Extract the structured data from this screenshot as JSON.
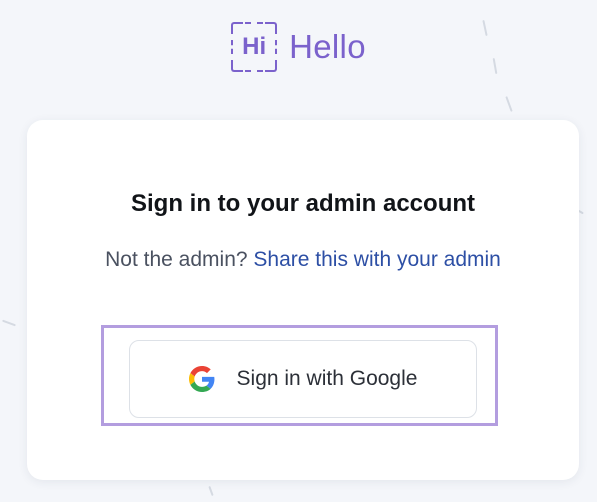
{
  "brand": {
    "mark_text": "Hi",
    "name": "Hello",
    "color": "#7b62cc"
  },
  "card": {
    "title": "Sign in to your admin account",
    "subtitle_prefix": "Not the admin?",
    "subtitle_link": "Share this with your admin",
    "google_button_label": "Sign in with Google",
    "google_icon": "google-g-icon",
    "link_color": "#2d4fa5",
    "focus_color": "#b39ddf"
  }
}
